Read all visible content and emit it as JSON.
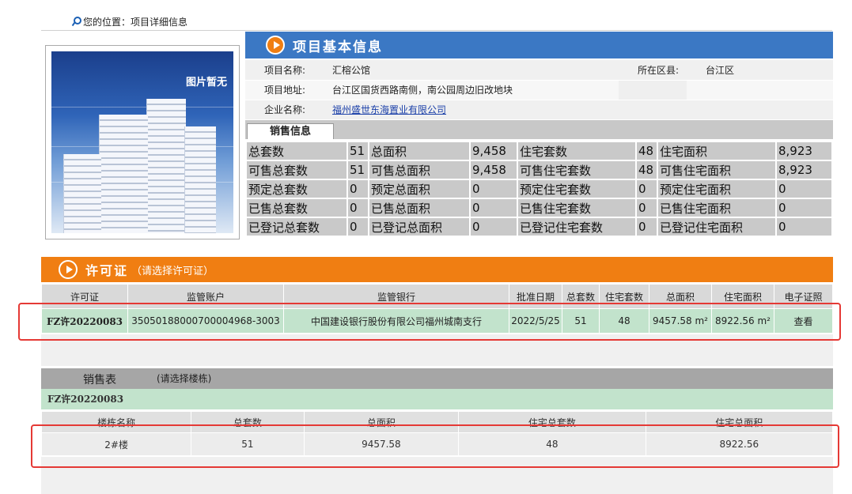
{
  "breadcrumb": {
    "label": "您的位置：项目详细信息"
  },
  "photo": {
    "placeholder_text": "图片暂无"
  },
  "basic": {
    "header": "项目基本信息",
    "name_label": "项目名称:",
    "name_value": "汇榕公馆",
    "district_label": "所在区县:",
    "district_value": "台江区",
    "address_label": "项目地址:",
    "address_value": "台江区国货西路南侧，南公园周边旧改地块",
    "company_label": "企业名称:",
    "company_value": "福州盛世东海置业有限公司"
  },
  "sales_info": {
    "tab_label": "销售信息",
    "rows": [
      [
        "总套数",
        "51",
        "总面积",
        "9,458",
        "住宅套数",
        "48",
        "住宅面积",
        "8,923"
      ],
      [
        "可售总套数",
        "51",
        "可售总面积",
        "9,458",
        "可售住宅套数",
        "48",
        "可售住宅面积",
        "8,923"
      ],
      [
        "预定总套数",
        "0",
        "预定总面积",
        "0",
        "预定住宅套数",
        "0",
        "预定住宅面积",
        "0"
      ],
      [
        "已售总套数",
        "0",
        "已售总面积",
        "0",
        "已售住宅套数",
        "0",
        "已售住宅面积",
        "0"
      ],
      [
        "已登记总套数",
        "0",
        "已登记总面积",
        "0",
        "已登记住宅套数",
        "0",
        "已登记住宅面积",
        "0"
      ]
    ]
  },
  "permit": {
    "header": "许可证",
    "header_sub": "（请选择许可证）",
    "columns": [
      "许可证",
      "监管账户",
      "监管银行",
      "批准日期",
      "总套数",
      "住宅套数",
      "总面积",
      "住宅面积",
      "电子证照"
    ],
    "row": {
      "permit_no": "FZ许20220083",
      "account": "35050188000700004968-3003",
      "bank": "中国建设银行股份有限公司福州城南支行",
      "date": "2022/5/25",
      "total_units": "51",
      "residential_units": "48",
      "total_area": "9457.58 m²",
      "residential_area": "8922.56 m²",
      "view_label": "查看"
    }
  },
  "sales_sheet": {
    "title": "销售表",
    "subtitle": "(请选择楼栋)",
    "permit_no": "FZ许20220083",
    "columns": [
      "楼栋名称",
      "总套数",
      "总面积",
      "住宅总套数",
      "住宅总面积"
    ],
    "row": [
      "2#楼",
      "51",
      "9457.58",
      "48",
      "8922.56"
    ]
  },
  "colors": {
    "blue_header": "#3b78c4",
    "orange_header": "#f07e12",
    "green_row": "#c2e3cc",
    "highlight_red": "#e53935"
  }
}
